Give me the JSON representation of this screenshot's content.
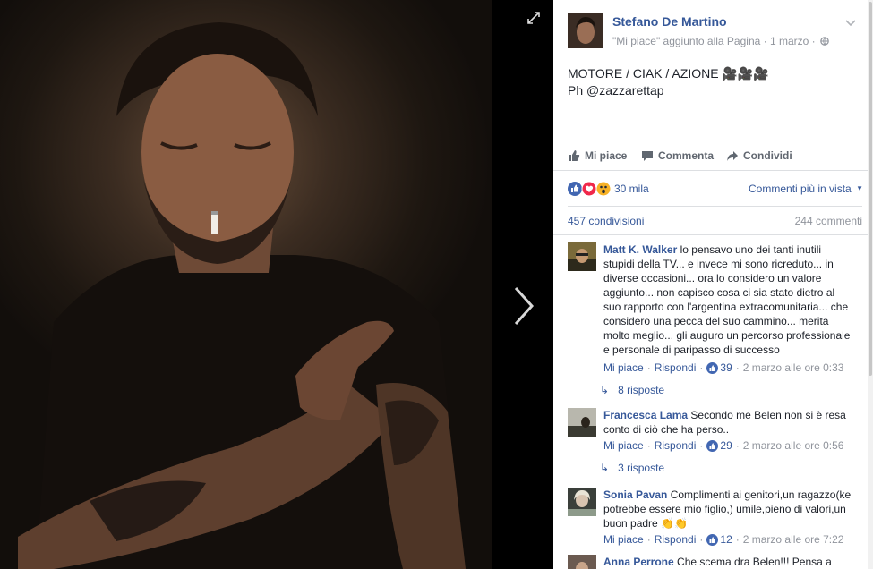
{
  "viewer": {
    "expand_icon": "expand-icon",
    "next_icon": "chevron-right-icon"
  },
  "post": {
    "author": "Stefano De Martino",
    "meta": "\"Mi piace\" aggiunto alla Pagina · 1 marzo ·",
    "text_lines": [
      "MOTORE / CIAK / AZIONE 🎥🎥🎥",
      "Ph @zazzarettap"
    ],
    "actions": {
      "like": "Mi piace",
      "comment": "Commenta",
      "share": "Condividi"
    },
    "reaction_count": "30 mila",
    "comment_order": "Commenti più in vista",
    "shares": "457 condivisioni",
    "comments_count": "244 commenti"
  },
  "comments": [
    {
      "name": "Matt K. Walker",
      "lines": [
        "lo pensavo uno dei tanti inutili",
        "stupidi della TV... e invece mi sono ricreduto... in",
        "diverse occasioni... ora lo considero un valore",
        "aggiunto... non capisco cosa ci sia stato dietro al",
        "suo rapporto con l'argentina extracomunitaria... che",
        "considero una pecca del suo cammino... merita",
        "molto meglio... gli auguro un percorso professionale",
        "e personale di paripasso di successo"
      ],
      "like": "Mi piace",
      "reply": "Rispondi",
      "likes": "39",
      "time": "2 marzo alle ore 0:33",
      "replies": "8 risposte"
    },
    {
      "name": "Francesca Lama",
      "lines": [
        "Secondo me Belen non si è resa",
        "conto di ciò che ha perso.."
      ],
      "like": "Mi piace",
      "reply": "Rispondi",
      "likes": "29",
      "time": "2 marzo alle ore 0:56",
      "replies": "3 risposte"
    },
    {
      "name": "Sonia Pavan",
      "lines": [
        "Complimenti ai genitori,un ragazzo(ke",
        "potrebbe essere mio figlio,) umile,pieno di valori,un",
        "buon padre 👏👏"
      ],
      "like": "Mi piace",
      "reply": "Rispondi",
      "likes": "12",
      "time": "2 marzo alle ore 7:22"
    },
    {
      "name": "Anna Perrone",
      "lines": [
        "Che scema dra Belen!!! Pensa a"
      ]
    }
  ]
}
